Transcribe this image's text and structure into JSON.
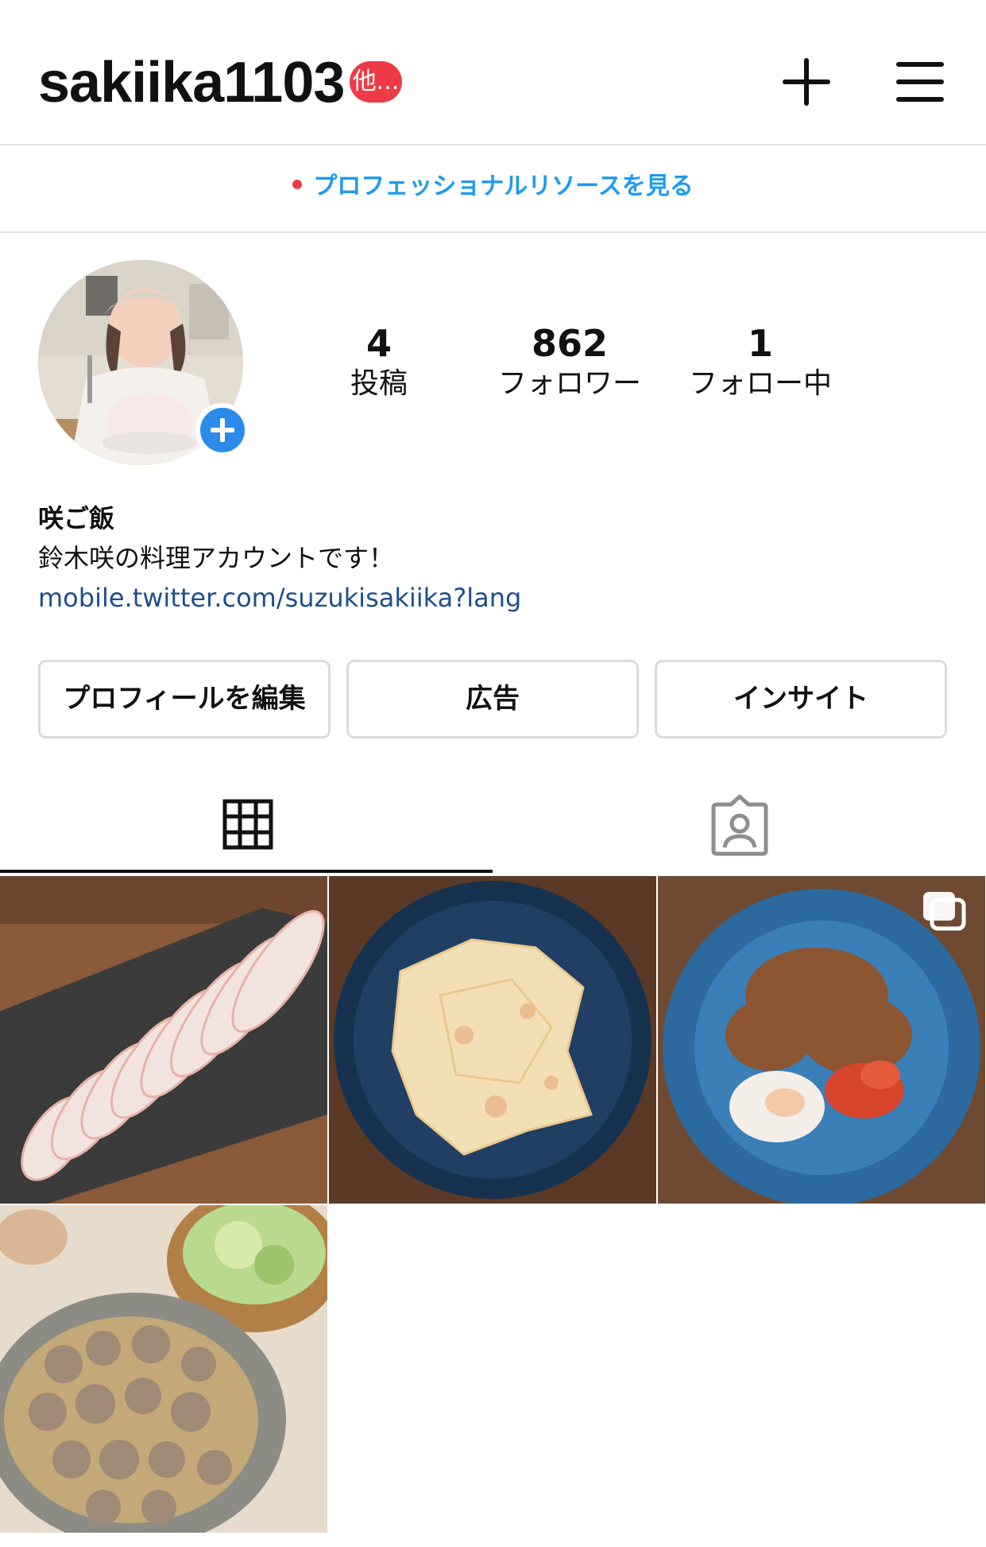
{
  "header": {
    "username": "sakiika1103",
    "notification_badge": "他...",
    "icons": [
      "plus-icon",
      "hamburger-menu-icon"
    ]
  },
  "pro_banner": {
    "label": "プロフェッショナルリソースを見る"
  },
  "stats": [
    {
      "value": "4",
      "label": "投稿"
    },
    {
      "value": "862",
      "label": "フォロワー"
    },
    {
      "value": "1",
      "label": "フォロー中"
    }
  ],
  "bio": {
    "name": "咲ご飯",
    "description": "鈴木咲の料理アカウントです！",
    "link": "mobile.twitter.com/suzukisakiika?lang"
  },
  "buttons": {
    "edit_profile": "プロフィールを編集",
    "ads": "広告",
    "insights": "インサイト"
  },
  "tabs": [
    "grid-icon",
    "tagged-icon"
  ],
  "posts": [
    {
      "name": "post-sashimi"
    },
    {
      "name": "post-cabbage"
    },
    {
      "name": "post-gyudon",
      "multi": true
    },
    {
      "name": "post-nabe"
    }
  ],
  "colors": {
    "accent_blue": "#1d9bf0",
    "badge_red": "#ee3b47",
    "link": "#1f4e8a"
  }
}
